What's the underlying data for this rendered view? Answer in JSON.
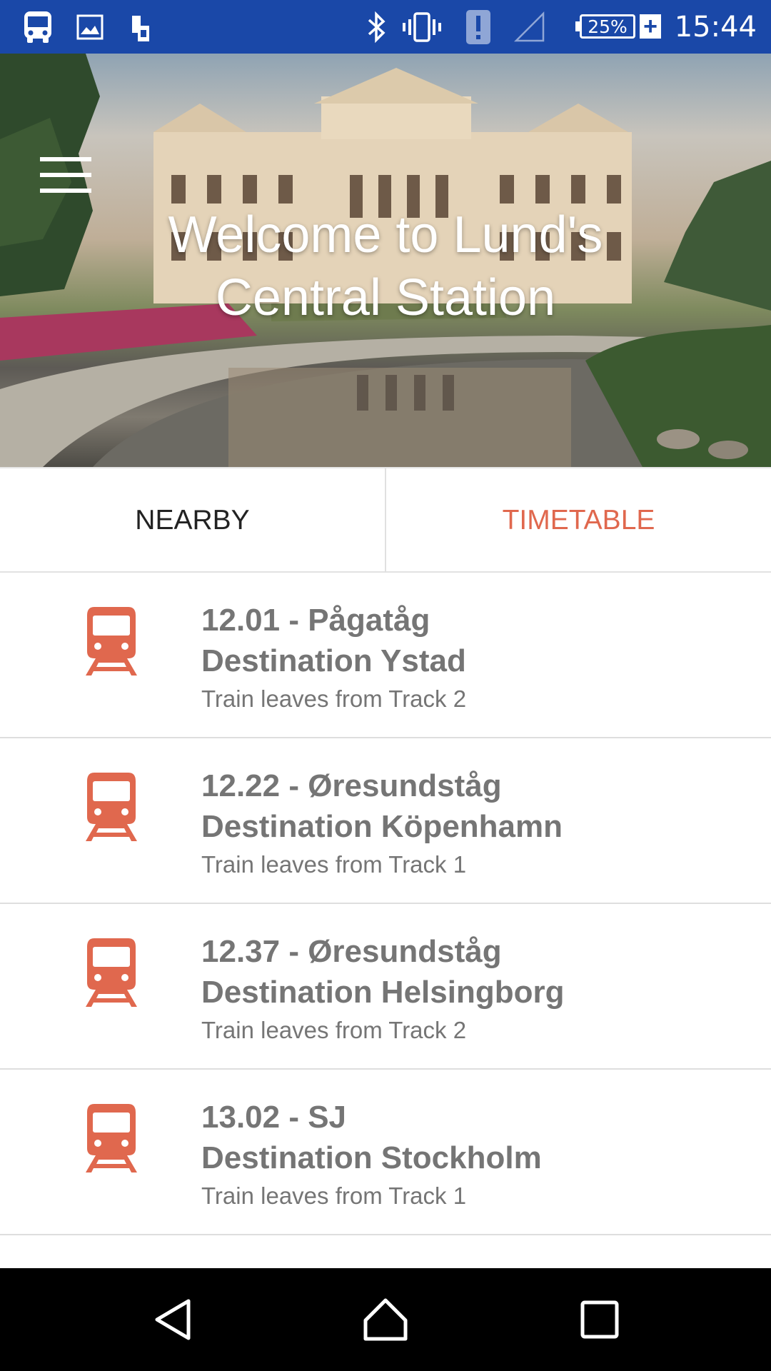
{
  "status_bar": {
    "time": "15:44",
    "battery": "25%",
    "left_icons": [
      "bus-icon",
      "image-icon",
      "sim-card-icon"
    ],
    "right_icons": [
      "bluetooth-icon",
      "vibrate-icon",
      "alert-icon",
      "signal-icon",
      "battery-icon"
    ]
  },
  "hero": {
    "title_line1": "Welcome to Lund's",
    "title_line2": "Central Station",
    "menu_icon": "hamburger-menu-icon"
  },
  "tabs": [
    {
      "label": "NEARBY",
      "active": false
    },
    {
      "label": "TIMETABLE",
      "active": true
    }
  ],
  "trains": [
    {
      "time_operator": "12.01 - Pågatåg",
      "destination": "Destination Ystad",
      "track": "Train leaves from Track 2"
    },
    {
      "time_operator": "12.22 - Øresundståg",
      "destination": "Destination Köpenhamn",
      "track": "Train leaves from Track 1"
    },
    {
      "time_operator": "12.37 - Øresundståg",
      "destination": "Destination Helsingborg",
      "track": "Train leaves from Track 2"
    },
    {
      "time_operator": "13.02 - SJ",
      "destination": "Destination Stockholm",
      "track": "Train leaves from Track 1"
    }
  ],
  "nav_bar": {
    "buttons": [
      "back-icon",
      "home-icon",
      "recents-icon"
    ]
  },
  "colors": {
    "status_bar": "#1a48a8",
    "accent": "#e0684e",
    "list_text": "#757575"
  }
}
